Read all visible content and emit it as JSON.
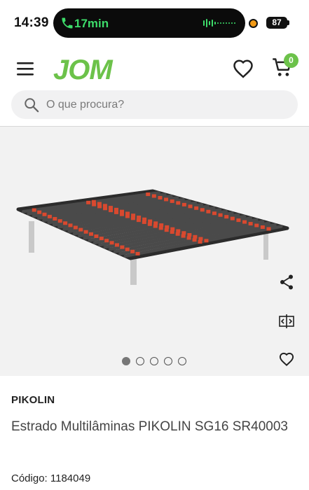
{
  "status_bar": {
    "time": "14:39",
    "call_duration": "17min",
    "battery": "87",
    "icons": [
      "phone-icon",
      "waveform-icon",
      "recording-dot-icon",
      "battery-icon"
    ]
  },
  "header": {
    "logo_text": "JOM",
    "cart_count": "0",
    "icons": [
      "menu-icon",
      "heart-icon",
      "cart-icon"
    ]
  },
  "search": {
    "placeholder": "O que procura?"
  },
  "gallery": {
    "image_alt": "Estrado de cama com lâminas",
    "slide_count": 5,
    "active_slide": 1,
    "actions": [
      "share-icon",
      "compare-icon",
      "heart-icon"
    ]
  },
  "product": {
    "brand": "PIKOLIN",
    "title": "Estrado Multilâminas PIKOLIN SG16 SR40003",
    "code_label": "Código:",
    "code_value": "1184049"
  },
  "colors": {
    "brand_green": "#6cc24a",
    "call_green": "#3ddc6a",
    "gallery_bg": "#f2f2f2",
    "slat_red": "#d9492f"
  }
}
